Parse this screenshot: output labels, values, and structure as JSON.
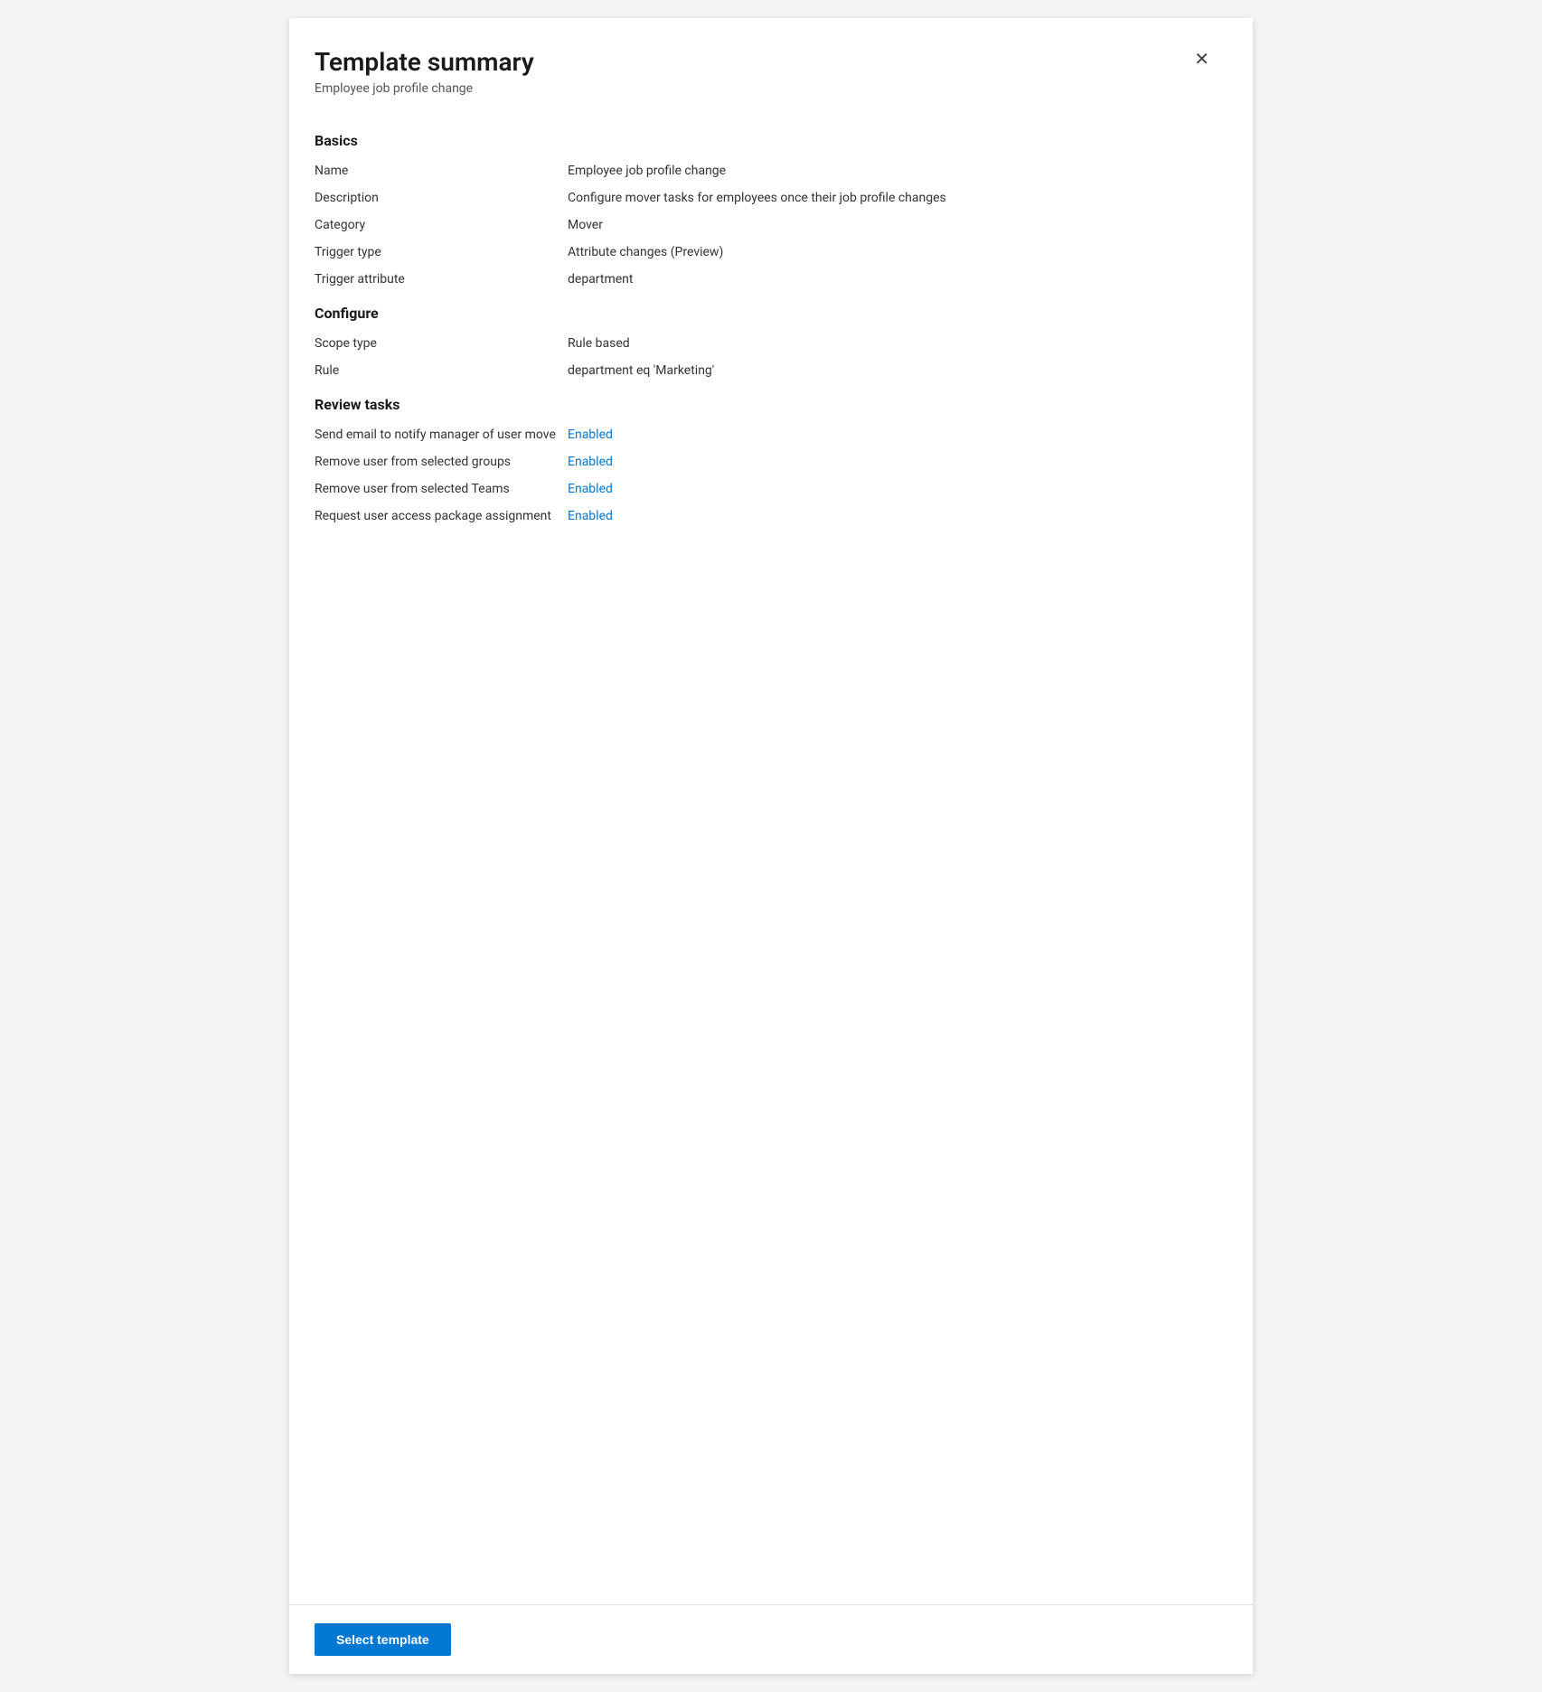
{
  "panel": {
    "title": "Template summary",
    "subtitle": "Employee job profile change",
    "close_icon": "✕"
  },
  "sections": {
    "basics": {
      "heading": "Basics",
      "rows": [
        {
          "label": "Name",
          "value": "Employee job profile change",
          "enabled": false
        },
        {
          "label": "Description",
          "value": "Configure mover tasks for employees once their job profile changes",
          "enabled": false
        },
        {
          "label": "Category",
          "value": "Mover",
          "enabled": false
        },
        {
          "label": "Trigger type",
          "value": "Attribute changes (Preview)",
          "enabled": false
        },
        {
          "label": "Trigger attribute",
          "value": "department",
          "enabled": false
        }
      ]
    },
    "configure": {
      "heading": "Configure",
      "rows": [
        {
          "label": "Scope type",
          "value": "Rule based",
          "enabled": false
        },
        {
          "label": "Rule",
          "value": "department eq 'Marketing'",
          "enabled": false
        }
      ]
    },
    "review_tasks": {
      "heading": "Review tasks",
      "rows": [
        {
          "label": "Send email to notify manager of user move",
          "value": "Enabled",
          "enabled": true
        },
        {
          "label": "Remove user from selected groups",
          "value": "Enabled",
          "enabled": true
        },
        {
          "label": "Remove user from selected Teams",
          "value": "Enabled",
          "enabled": true
        },
        {
          "label": "Request user access package assignment",
          "value": "Enabled",
          "enabled": true
        }
      ]
    }
  },
  "footer": {
    "select_template_label": "Select template"
  }
}
